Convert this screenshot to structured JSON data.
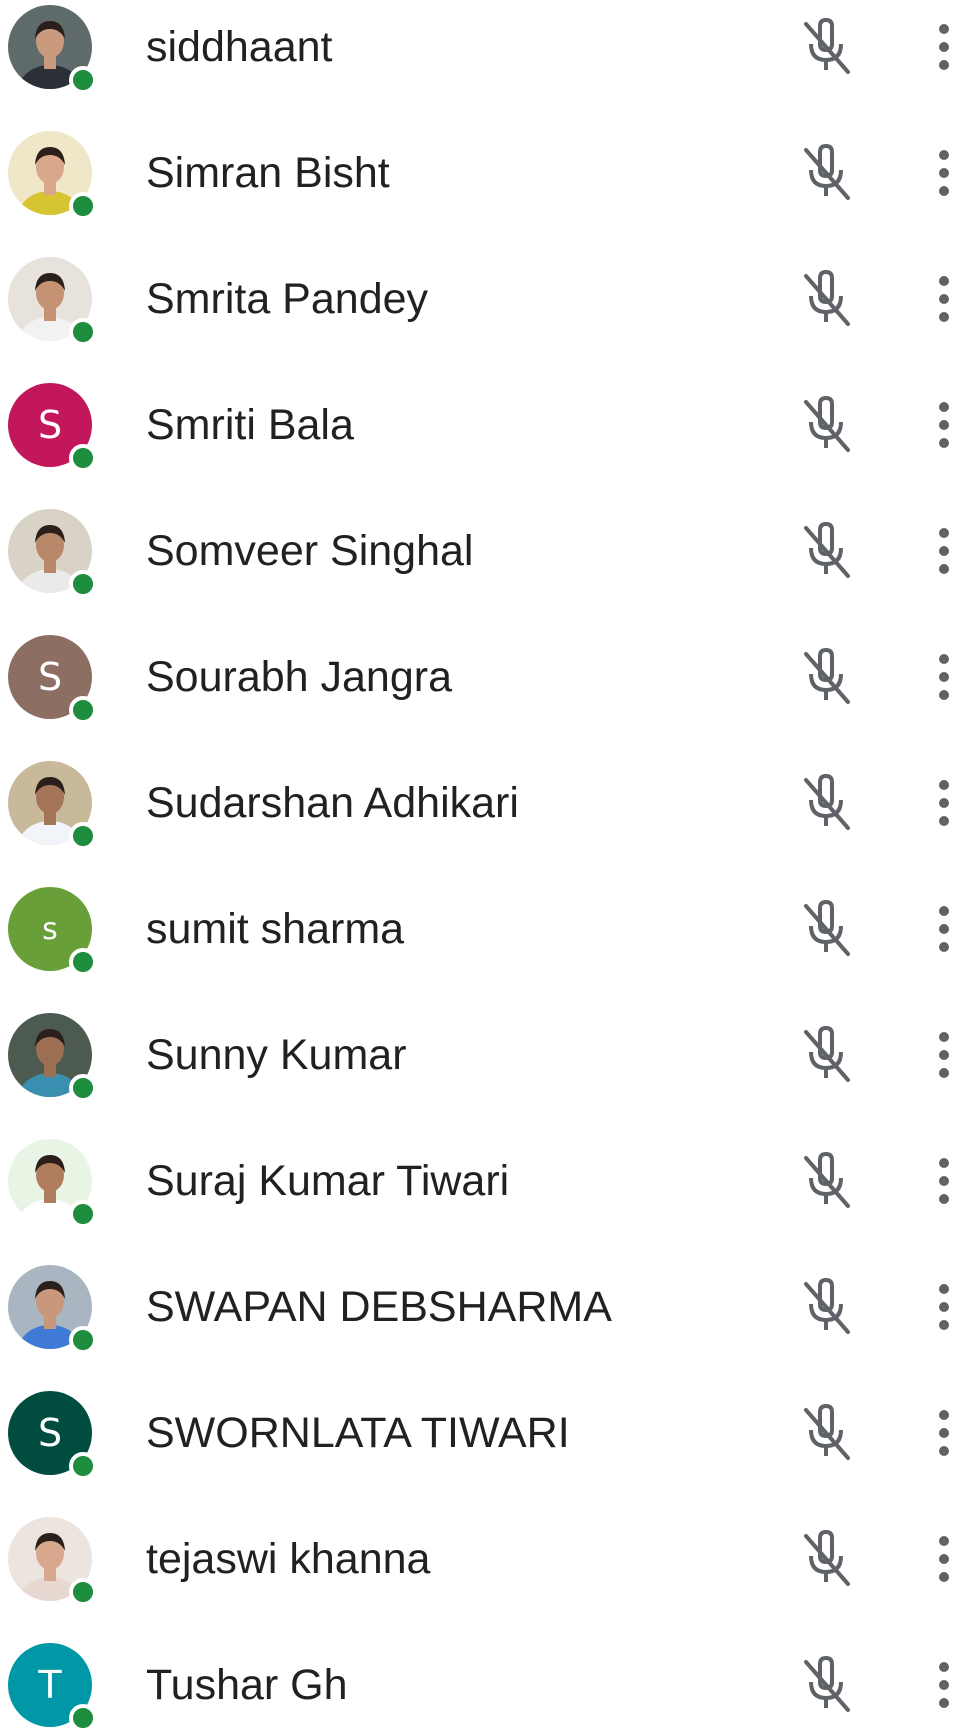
{
  "participants": [
    {
      "name": "siddhaant",
      "avatar": {
        "type": "photo",
        "bg": "#5f6b6a",
        "skin": "#c99a7e",
        "shirt": "#2b2f36"
      }
    },
    {
      "name": "Simran Bisht",
      "avatar": {
        "type": "photo",
        "bg": "#f0e6c8",
        "skin": "#d9a78a",
        "shirt": "#d6c531"
      }
    },
    {
      "name": "Smrita Pandey",
      "avatar": {
        "type": "photo",
        "bg": "#e8e2dc",
        "skin": "#c59273",
        "shirt": "#f2f2f2"
      }
    },
    {
      "name": "Smriti Bala",
      "avatar": {
        "type": "letter",
        "letter": "S",
        "bg": "#c2185b"
      }
    },
    {
      "name": "Somveer Singhal",
      "avatar": {
        "type": "photo",
        "bg": "#d9d3c7",
        "skin": "#b9876a",
        "shirt": "#eaeaea"
      }
    },
    {
      "name": "Sourabh Jangra",
      "avatar": {
        "type": "letter",
        "letter": "S",
        "bg": "#8d6e63"
      }
    },
    {
      "name": "Sudarshan Adhikari",
      "avatar": {
        "type": "photo",
        "bg": "#c8b99a",
        "skin": "#a47458",
        "shirt": "#f1f4f8"
      }
    },
    {
      "name": "sumit sharma",
      "avatar": {
        "type": "letter",
        "letter": "s",
        "bg": "#689f38"
      }
    },
    {
      "name": "Sunny Kumar",
      "avatar": {
        "type": "photo",
        "bg": "#4d5a4f",
        "skin": "#9c6e52",
        "shirt": "#3a8fb0"
      }
    },
    {
      "name": "Suraj Kumar Tiwari",
      "avatar": {
        "type": "photo",
        "bg": "#e9f5e4",
        "skin": "#b07c5e",
        "shirt": "#ffffff"
      }
    },
    {
      "name": "SWAPAN DEBSHARMA",
      "avatar": {
        "type": "photo",
        "bg": "#a9b6c2",
        "skin": "#c9987c",
        "shirt": "#3f7bd6"
      }
    },
    {
      "name": "SWORNLATA TIWARI",
      "avatar": {
        "type": "letter",
        "letter": "S",
        "bg": "#004d40"
      }
    },
    {
      "name": "tejaswi khanna",
      "avatar": {
        "type": "photo",
        "bg": "#ece4df",
        "skin": "#d7a88d",
        "shirt": "#e7d9d2"
      }
    },
    {
      "name": "Tushar Gh",
      "avatar": {
        "type": "letter",
        "letter": "T",
        "bg": "#0097a7"
      }
    }
  ],
  "colors": {
    "presence": "#1e8e3e",
    "icon": "#5f6368",
    "text": "#202124"
  },
  "icons": {
    "mic": "mic-off-icon",
    "more": "more-vert-icon"
  }
}
